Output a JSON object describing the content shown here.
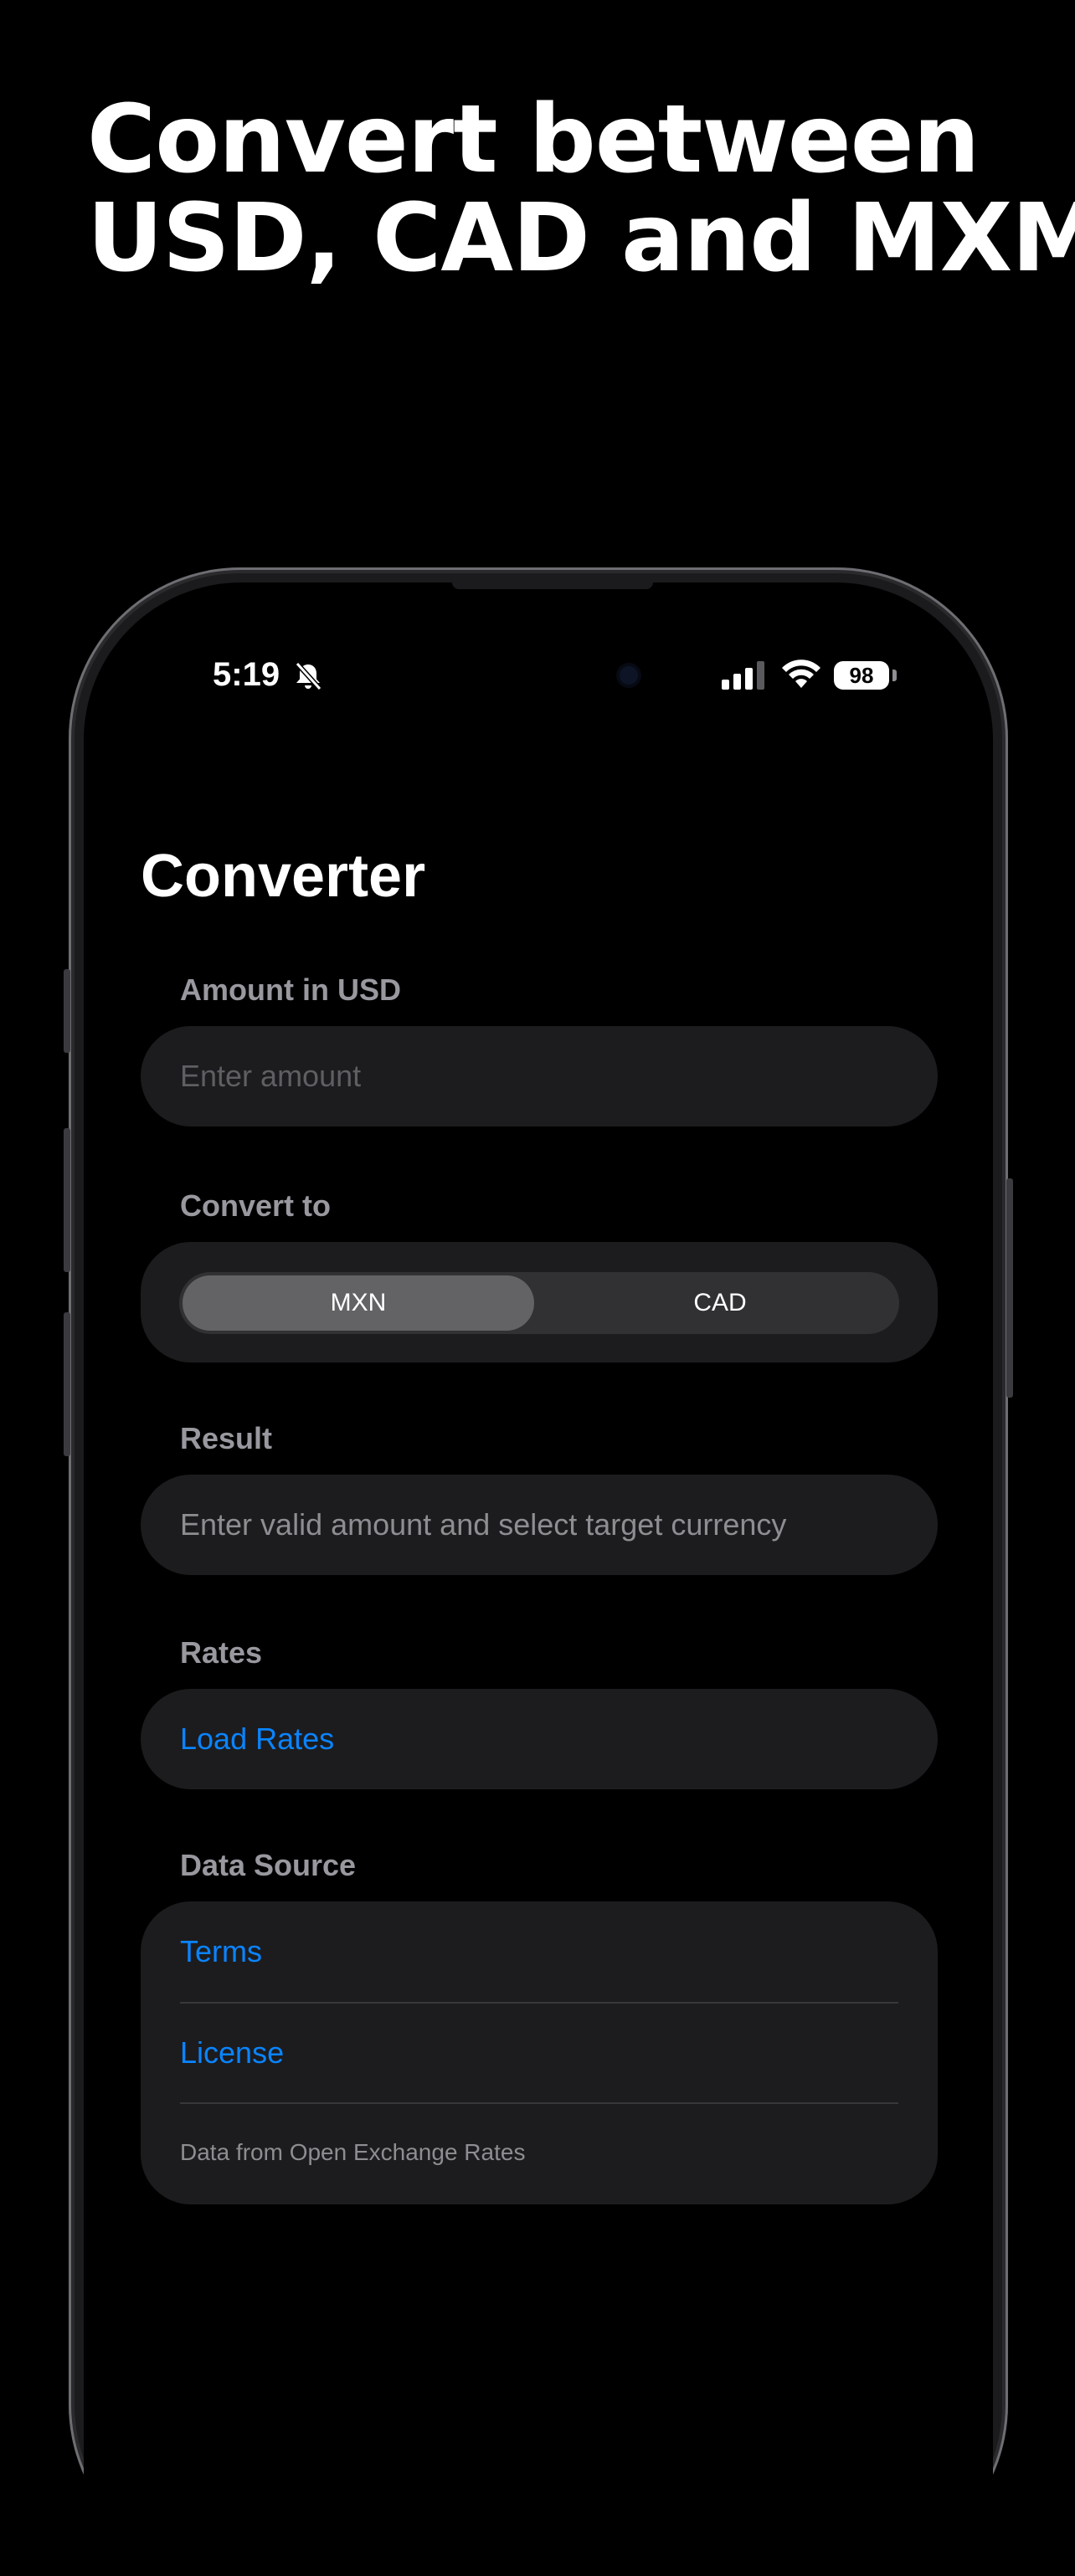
{
  "headline": {
    "line1": "Convert between",
    "line2": "USD, CAD and MXM"
  },
  "status_bar": {
    "time": "5:19",
    "battery": "98",
    "icons": [
      "bell-slash-icon",
      "signal-icon",
      "wifi-icon",
      "battery-icon"
    ]
  },
  "app": {
    "title": "Converter",
    "amount": {
      "label": "Amount in USD",
      "placeholder": "Enter amount",
      "value": ""
    },
    "convert_to": {
      "label": "Convert to",
      "options": [
        "MXN",
        "CAD"
      ],
      "selected": "MXN"
    },
    "result": {
      "label": "Result",
      "text": "Enter valid amount and select target currency"
    },
    "rates": {
      "label": "Rates",
      "load_button": "Load Rates"
    },
    "data_source": {
      "label": "Data Source",
      "terms": "Terms",
      "license": "License",
      "footnote": "Data from Open Exchange Rates"
    }
  },
  "colors": {
    "background": "#000000",
    "card": "#1c1c1e",
    "link": "#0a84ff",
    "segment_selected": "#636366",
    "secondary_text": "#98989f"
  }
}
